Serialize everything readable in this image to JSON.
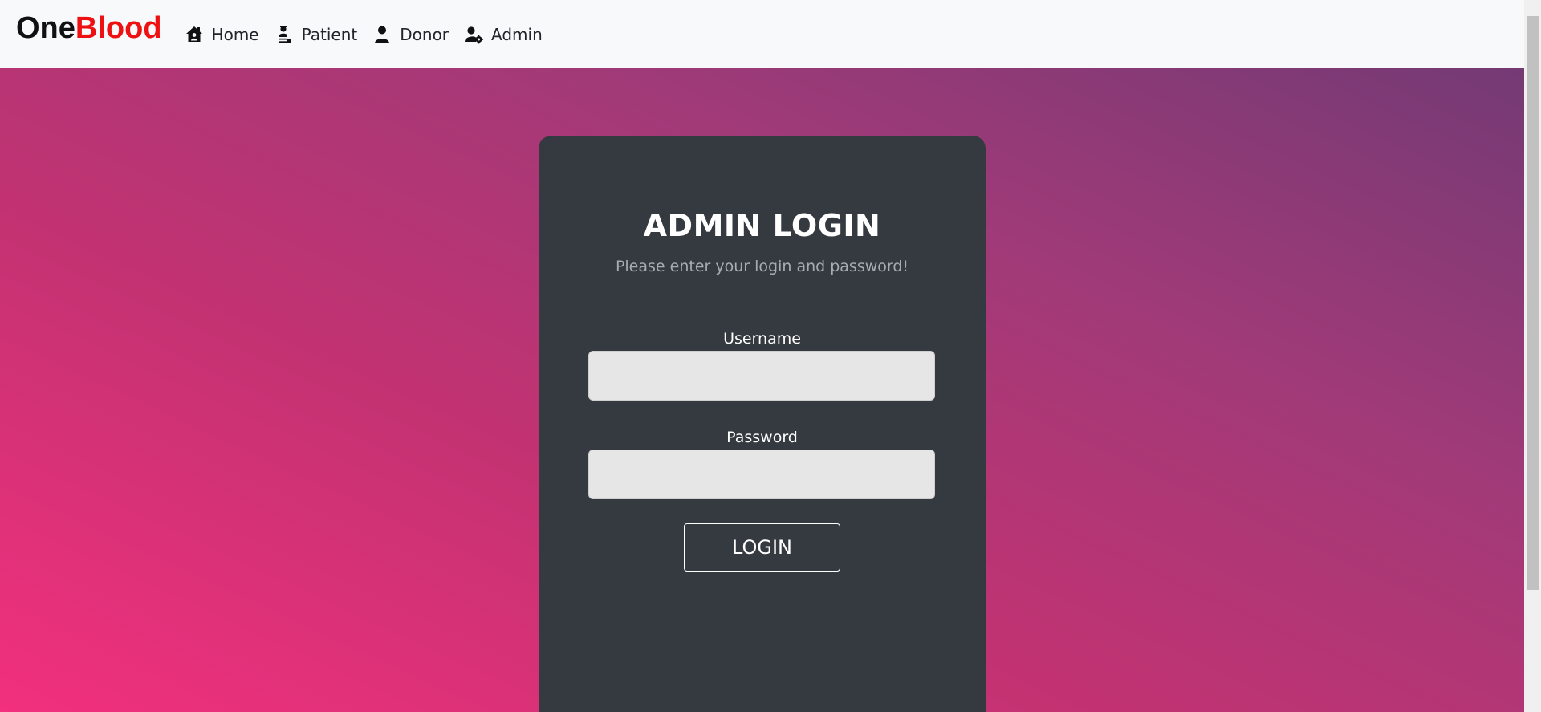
{
  "navbar": {
    "brand_part1": "One",
    "brand_part2": "Blood",
    "brand_colors": {
      "one": "#111111",
      "blood": "#ee1111"
    },
    "items": [
      {
        "label": "Home",
        "icon": "house-user-icon"
      },
      {
        "label": "Patient",
        "icon": "patient-icon"
      },
      {
        "label": "Donor",
        "icon": "user-icon"
      },
      {
        "label": "Admin",
        "icon": "user-gear-icon"
      }
    ]
  },
  "login": {
    "title": "ADMIN LOGIN",
    "subtitle": "Please enter your login and password!",
    "username_label": "Username",
    "username_value": "",
    "password_label": "Password",
    "password_value": "",
    "button_label": "LOGIN"
  },
  "colors": {
    "card_background": "#343a40",
    "navbar_background": "#f8f9fa",
    "gradient_start": "#f2307d",
    "gradient_end": "#6c3a74"
  }
}
